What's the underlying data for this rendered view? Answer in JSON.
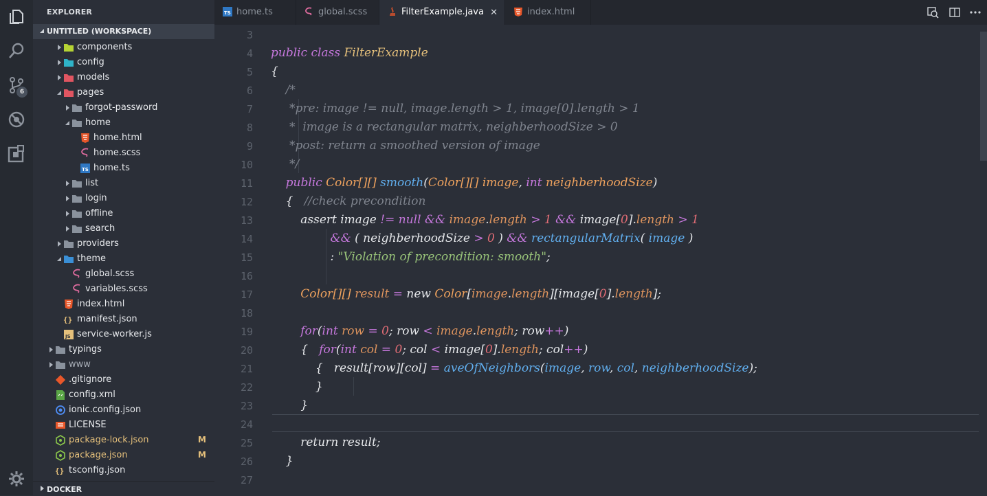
{
  "sidebar": {
    "title": "EXPLORER",
    "workspace": "UNTITLED (WORKSPACE)",
    "items": [
      {
        "label": "components",
        "modified": ""
      },
      {
        "label": "config",
        "modified": ""
      },
      {
        "label": "models",
        "modified": ""
      },
      {
        "label": "pages",
        "modified": ""
      },
      {
        "label": "forgot-password",
        "modified": ""
      },
      {
        "label": "home",
        "modified": ""
      },
      {
        "label": "home.html",
        "modified": ""
      },
      {
        "label": "home.scss",
        "modified": ""
      },
      {
        "label": "home.ts",
        "modified": ""
      },
      {
        "label": "list",
        "modified": ""
      },
      {
        "label": "login",
        "modified": ""
      },
      {
        "label": "offline",
        "modified": ""
      },
      {
        "label": "search",
        "modified": ""
      },
      {
        "label": "providers",
        "modified": ""
      },
      {
        "label": "theme",
        "modified": ""
      },
      {
        "label": "global.scss",
        "modified": ""
      },
      {
        "label": "variables.scss",
        "modified": ""
      },
      {
        "label": "index.html",
        "modified": ""
      },
      {
        "label": "manifest.json",
        "modified": ""
      },
      {
        "label": "service-worker.js",
        "modified": ""
      },
      {
        "label": "typings",
        "modified": ""
      },
      {
        "label": "www",
        "modified": ""
      },
      {
        "label": ".gitignore",
        "modified": ""
      },
      {
        "label": "config.xml",
        "modified": ""
      },
      {
        "label": "ionic.config.json",
        "modified": ""
      },
      {
        "label": "LICENSE",
        "modified": ""
      },
      {
        "label": "package-lock.json",
        "modified": "M"
      },
      {
        "label": "package.json",
        "modified": "M"
      },
      {
        "label": "tsconfig.json",
        "modified": ""
      }
    ],
    "docker": "DOCKER"
  },
  "activity": {
    "scm_badge": "6"
  },
  "tabs": [
    {
      "label": "home.ts",
      "active": false
    },
    {
      "label": "global.scss",
      "active": false
    },
    {
      "label": "FilterExample.java",
      "active": true,
      "close": "✕"
    },
    {
      "label": "index.html",
      "active": false
    }
  ],
  "editor": {
    "line_numbers": [
      "3",
      "4",
      "5",
      "6",
      "7",
      "8",
      "9",
      "10",
      "11",
      "12",
      "13",
      "14",
      "15",
      "16",
      "17",
      "18",
      "19",
      "20",
      "21",
      "22",
      "23",
      "24",
      "25",
      "26",
      "27"
    ],
    "lines": [
      [],
      [
        [
          "k",
          "public"
        ],
        [
          "v",
          " "
        ],
        [
          "k",
          "class"
        ],
        [
          "v",
          " "
        ],
        [
          "cl",
          "FilterExample"
        ]
      ],
      [
        [
          "v",
          "{"
        ]
      ],
      [
        [
          "v",
          "    "
        ],
        [
          "cm",
          "/*"
        ]
      ],
      [
        [
          "v",
          "    "
        ],
        [
          "cm",
          " *pre: image != null, image.length > 1, image[0].length > 1"
        ]
      ],
      [
        [
          "v",
          "    "
        ],
        [
          "cm",
          " *  image is a rectangular matrix, neighberhoodSize > 0"
        ]
      ],
      [
        [
          "v",
          "    "
        ],
        [
          "cm",
          " *post: return a smoothed version of image"
        ]
      ],
      [
        [
          "v",
          "    "
        ],
        [
          "cm",
          " */"
        ]
      ],
      [
        [
          "v",
          "    "
        ],
        [
          "k",
          "public"
        ],
        [
          "v",
          " "
        ],
        [
          "ty",
          "Color[][]"
        ],
        [
          "v",
          " "
        ],
        [
          "fn",
          "smooth"
        ],
        [
          "v",
          "("
        ],
        [
          "ty",
          "Color[][]"
        ],
        [
          "v",
          " "
        ],
        [
          "pa",
          "image"
        ],
        [
          "v",
          ", "
        ],
        [
          "k",
          "int"
        ],
        [
          "v",
          " "
        ],
        [
          "pa",
          "neighberhoodSize"
        ],
        [
          "v",
          ")"
        ]
      ],
      [
        [
          "v",
          "    {   "
        ],
        [
          "cm",
          "//check precondition"
        ]
      ],
      [
        [
          "v",
          "        assert image "
        ],
        [
          "op",
          "!="
        ],
        [
          "v",
          " "
        ],
        [
          "op",
          "null"
        ],
        [
          "v",
          " "
        ],
        [
          "op",
          "&&"
        ],
        [
          "v",
          " "
        ],
        [
          "pr",
          "image"
        ],
        [
          "v",
          "."
        ],
        [
          "pr",
          "length"
        ],
        [
          "v",
          " "
        ],
        [
          "op",
          ">"
        ],
        [
          "v",
          " "
        ],
        [
          "nu",
          "1"
        ],
        [
          "v",
          " "
        ],
        [
          "op",
          "&&"
        ],
        [
          "v",
          " image["
        ],
        [
          "nu",
          "0"
        ],
        [
          "v",
          "]."
        ],
        [
          "pr",
          "length"
        ],
        [
          "v",
          " "
        ],
        [
          "op",
          ">"
        ],
        [
          "v",
          " "
        ],
        [
          "nu",
          "1"
        ]
      ],
      [
        [
          "v",
          "                "
        ],
        [
          "op",
          "&&"
        ],
        [
          "v",
          " ( neighberhoodSize "
        ],
        [
          "op",
          ">"
        ],
        [
          "v",
          " "
        ],
        [
          "nu",
          "0"
        ],
        [
          "v",
          " ) "
        ],
        [
          "op",
          "&&"
        ],
        [
          "v",
          " "
        ],
        [
          "fn",
          "rectangularMatrix"
        ],
        [
          "v",
          "( "
        ],
        [
          "fn",
          "image"
        ],
        [
          "v",
          " )"
        ]
      ],
      [
        [
          "v",
          "                : "
        ],
        [
          "st",
          "\"Violation of precondition: smooth\""
        ],
        [
          "v",
          ";"
        ]
      ],
      [],
      [
        [
          "v",
          "        "
        ],
        [
          "ty",
          "Color[][]"
        ],
        [
          "v",
          " "
        ],
        [
          "pr",
          "result"
        ],
        [
          "v",
          " "
        ],
        [
          "op",
          "="
        ],
        [
          "v",
          " new "
        ],
        [
          "ty",
          "Color"
        ],
        [
          "v",
          "["
        ],
        [
          "pr",
          "image"
        ],
        [
          "v",
          "."
        ],
        [
          "pr",
          "length"
        ],
        [
          "v",
          "][image["
        ],
        [
          "nu",
          "0"
        ],
        [
          "v",
          "]."
        ],
        [
          "pr",
          "length"
        ],
        [
          "v",
          "];"
        ]
      ],
      [],
      [
        [
          "v",
          "        "
        ],
        [
          "k",
          "for"
        ],
        [
          "v",
          "("
        ],
        [
          "k",
          "int"
        ],
        [
          "v",
          " "
        ],
        [
          "pr",
          "row"
        ],
        [
          "v",
          " "
        ],
        [
          "op",
          "="
        ],
        [
          "v",
          " "
        ],
        [
          "nu",
          "0"
        ],
        [
          "v",
          "; row "
        ],
        [
          "op",
          "<"
        ],
        [
          "v",
          " "
        ],
        [
          "pr",
          "image"
        ],
        [
          "v",
          "."
        ],
        [
          "pr",
          "length"
        ],
        [
          "v",
          "; row"
        ],
        [
          "op",
          "++"
        ],
        [
          "v",
          ")"
        ]
      ],
      [
        [
          "v",
          "        {   "
        ],
        [
          "k",
          "for"
        ],
        [
          "v",
          "("
        ],
        [
          "k",
          "int"
        ],
        [
          "v",
          " "
        ],
        [
          "pr",
          "col"
        ],
        [
          "v",
          " "
        ],
        [
          "op",
          "="
        ],
        [
          "v",
          " "
        ],
        [
          "nu",
          "0"
        ],
        [
          "v",
          "; col "
        ],
        [
          "op",
          "<"
        ],
        [
          "v",
          " image["
        ],
        [
          "nu",
          "0"
        ],
        [
          "v",
          "]."
        ],
        [
          "pr",
          "length"
        ],
        [
          "v",
          "; col"
        ],
        [
          "op",
          "++"
        ],
        [
          "v",
          ")"
        ]
      ],
      [
        [
          "v",
          "            {   result[row][col] "
        ],
        [
          "op",
          "="
        ],
        [
          "v",
          " "
        ],
        [
          "fn",
          "aveOfNeighbors"
        ],
        [
          "v",
          "("
        ],
        [
          "fn",
          "image"
        ],
        [
          "v",
          ", "
        ],
        [
          "fn",
          "row"
        ],
        [
          "v",
          ", "
        ],
        [
          "fn",
          "col"
        ],
        [
          "v",
          ", "
        ],
        [
          "fn",
          "neighberhoodSize"
        ],
        [
          "v",
          ");"
        ]
      ],
      [
        [
          "v",
          "            }"
        ]
      ],
      [
        [
          "v",
          "        }"
        ]
      ],
      [],
      [
        [
          "v",
          "        return result;"
        ]
      ],
      [
        [
          "v",
          "    }"
        ]
      ],
      []
    ]
  },
  "colors": {
    "accent": "#61afef",
    "modified": "#e5c07b",
    "keyword": "#c678dd"
  }
}
